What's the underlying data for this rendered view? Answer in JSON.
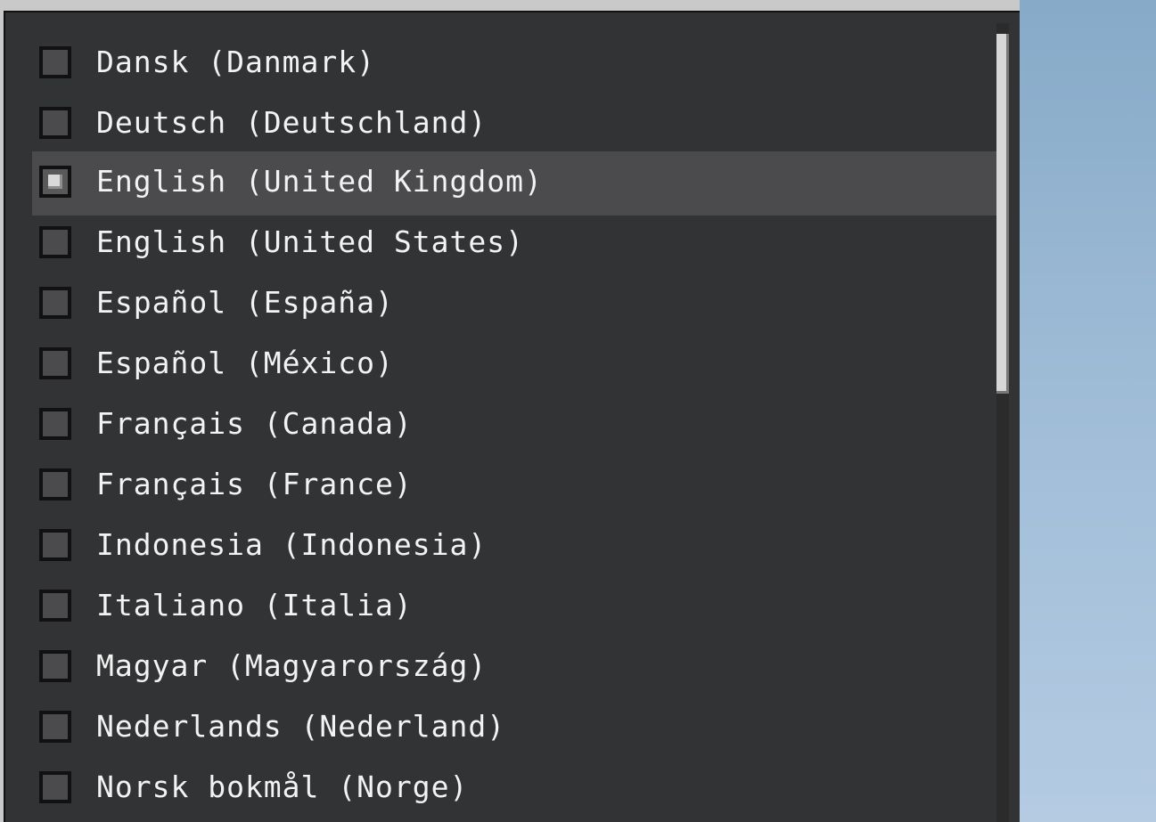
{
  "languages": [
    {
      "label": "Dansk (Danmark)",
      "selected": false
    },
    {
      "label": "Deutsch (Deutschland)",
      "selected": false
    },
    {
      "label": "English (United Kingdom)",
      "selected": true
    },
    {
      "label": "English (United States)",
      "selected": false
    },
    {
      "label": "Español (España)",
      "selected": false
    },
    {
      "label": "Español (México)",
      "selected": false
    },
    {
      "label": "Français (Canada)",
      "selected": false
    },
    {
      "label": "Français (France)",
      "selected": false
    },
    {
      "label": "Indonesia (Indonesia)",
      "selected": false
    },
    {
      "label": "Italiano (Italia)",
      "selected": false
    },
    {
      "label": "Magyar (Magyarország)",
      "selected": false
    },
    {
      "label": "Nederlands (Nederland)",
      "selected": false
    },
    {
      "label": "Norsk bokmål (Norge)",
      "selected": false
    }
  ],
  "scroll": {
    "visible_fraction": 0.44,
    "offset_fraction": 0.0
  },
  "colors": {
    "panel_background": "#323335",
    "selected_row": "#4b4a4d",
    "text": "#f3f3f3"
  }
}
